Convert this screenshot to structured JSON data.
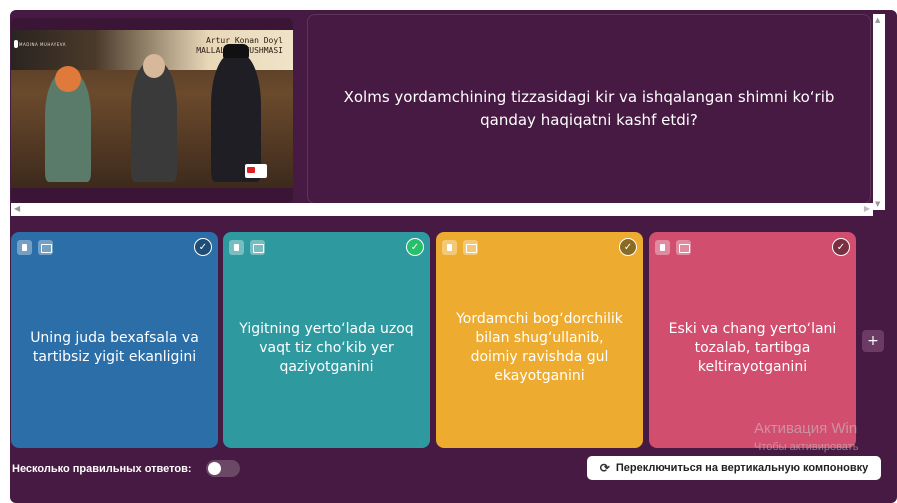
{
  "media": {
    "author": "Artur Konan Doyl",
    "book_title": "MALLALAR UYUSHMASI",
    "narrator": "MADINA MUHAYEVA"
  },
  "question": {
    "text": "Xolms yordamchining tizzasidagi kir va ishqalangan shimni ko‘rib qanday haqiqatni kashf etdi?"
  },
  "answers": [
    {
      "text": "Uning juda bexafsala va tartibsiz yigit ekanligini",
      "color": "#2c6ea8",
      "correct": false
    },
    {
      "text": "Yigitning yerto‘lada uzoq vaqt tiz cho‘kib yer qaziyotganini",
      "color": "#2e9aa0",
      "correct": true
    },
    {
      "text": "Yordamchi bog‘dorchilik bilan shug‘ullanib, doimiy ravishda gul ekayotganini",
      "color": "#edab2f",
      "correct": false
    },
    {
      "text": "Eski va chang yerto‘lani tozalab, tartibga keltirayotganini",
      "color": "#d24e6f",
      "correct": false
    }
  ],
  "footer": {
    "multi_label": "Несколько правильных ответов:",
    "multi_enabled": false,
    "switch_label": "Переключиться на вертикальную компоновку"
  },
  "add_label": "+",
  "watermark": {
    "line1": "Активация Win",
    "line2": "Чтобы активировать"
  }
}
